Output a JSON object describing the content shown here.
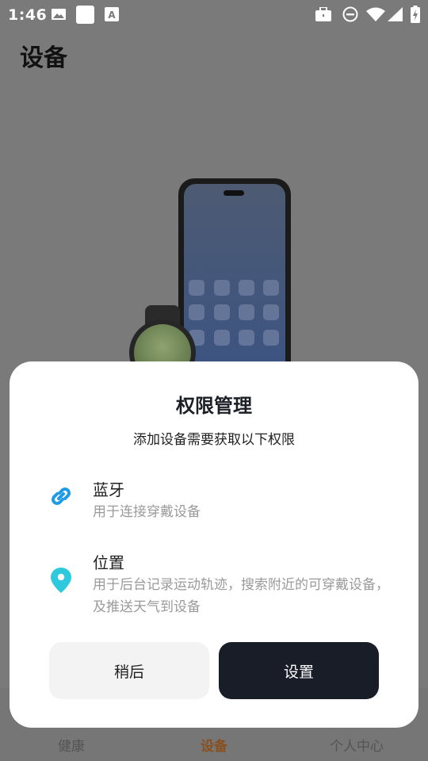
{
  "status_bar": {
    "time": "1:46",
    "icons": [
      "image-icon",
      "square-icon",
      "keyboard-a-icon",
      "briefcase-icon",
      "do-not-disturb-icon",
      "wifi-icon",
      "signal-icon",
      "battery-icon"
    ]
  },
  "page": {
    "title": "设备"
  },
  "dialog": {
    "title": "权限管理",
    "subtitle": "添加设备需要获取以下权限",
    "permissions": [
      {
        "name": "蓝牙",
        "description": "用于连接穿戴设备",
        "icon": "link-icon",
        "color": "#1e9be6"
      },
      {
        "name": "位置",
        "description": "用于后台记录运动轨迹，搜索附近的可穿戴设备，及推送天气到设备",
        "icon": "location-pin-icon",
        "color": "#2ec9dc"
      }
    ],
    "later_label": "稍后",
    "settings_label": "设置"
  },
  "bottom_nav": {
    "items": [
      {
        "label": "健康",
        "active": false
      },
      {
        "label": "设备",
        "active": true
      },
      {
        "label": "个人中心",
        "active": false
      }
    ]
  },
  "colors": {
    "accent": "#8a4f1e",
    "primary_button": "#181d28",
    "dim_overlay": "#7a7a7a"
  }
}
